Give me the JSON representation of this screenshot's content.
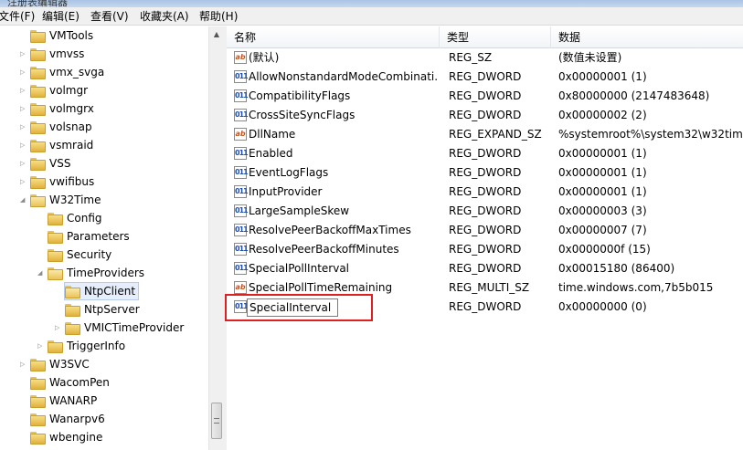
{
  "window": {
    "title": "注册表编辑器"
  },
  "menu": {
    "file": "文件(F)",
    "edit": "编辑(E)",
    "view": "查看(V)",
    "favorites": "收藏夹(A)",
    "help": "帮助(H)"
  },
  "tree": {
    "items": [
      {
        "label": "VMTools",
        "level": 1,
        "expander": ""
      },
      {
        "label": "vmvss",
        "level": 1,
        "expander": "▷"
      },
      {
        "label": "vmx_svga",
        "level": 1,
        "expander": "▷"
      },
      {
        "label": "volmgr",
        "level": 1,
        "expander": "▷"
      },
      {
        "label": "volmgrx",
        "level": 1,
        "expander": "▷"
      },
      {
        "label": "volsnap",
        "level": 1,
        "expander": "▷"
      },
      {
        "label": "vsmraid",
        "level": 1,
        "expander": "▷"
      },
      {
        "label": "VSS",
        "level": 1,
        "expander": "▷"
      },
      {
        "label": "vwifibus",
        "level": 1,
        "expander": "▷"
      },
      {
        "label": "W32Time",
        "level": 1,
        "expander": "◢"
      },
      {
        "label": "Config",
        "level": 2,
        "expander": ""
      },
      {
        "label": "Parameters",
        "level": 2,
        "expander": ""
      },
      {
        "label": "Security",
        "level": 2,
        "expander": ""
      },
      {
        "label": "TimeProviders",
        "level": 2,
        "expander": "◢"
      },
      {
        "label": "NtpClient",
        "level": 3,
        "expander": ""
      },
      {
        "label": "NtpServer",
        "level": 3,
        "expander": ""
      },
      {
        "label": "VMICTimeProvider",
        "level": 3,
        "expander": "▷"
      },
      {
        "label": "TriggerInfo",
        "level": 2,
        "expander": "▷"
      },
      {
        "label": "W3SVC",
        "level": 1,
        "expander": "▷"
      },
      {
        "label": "WacomPen",
        "level": 1,
        "expander": ""
      },
      {
        "label": "WANARP",
        "level": 1,
        "expander": ""
      },
      {
        "label": "Wanarpv6",
        "level": 1,
        "expander": ""
      },
      {
        "label": "wbengine",
        "level": 1,
        "expander": ""
      }
    ]
  },
  "list": {
    "columns": {
      "name": "名称",
      "type": "类型",
      "data": "数据"
    },
    "rows": [
      {
        "icon": "ab",
        "name": "(默认)",
        "type": "REG_SZ",
        "data": "(数值未设置)"
      },
      {
        "icon": "011",
        "name": "AllowNonstandardModeCombinati...",
        "type": "REG_DWORD",
        "data": "0x00000001 (1)"
      },
      {
        "icon": "011",
        "name": "CompatibilityFlags",
        "type": "REG_DWORD",
        "data": "0x80000000 (2147483648)"
      },
      {
        "icon": "011",
        "name": "CrossSiteSyncFlags",
        "type": "REG_DWORD",
        "data": "0x00000002 (2)"
      },
      {
        "icon": "ab",
        "name": "DllName",
        "type": "REG_EXPAND_SZ",
        "data": "%systemroot%\\system32\\w32time"
      },
      {
        "icon": "011",
        "name": "Enabled",
        "type": "REG_DWORD",
        "data": "0x00000001 (1)"
      },
      {
        "icon": "011",
        "name": "EventLogFlags",
        "type": "REG_DWORD",
        "data": "0x00000001 (1)"
      },
      {
        "icon": "011",
        "name": "InputProvider",
        "type": "REG_DWORD",
        "data": "0x00000001 (1)"
      },
      {
        "icon": "011",
        "name": "LargeSampleSkew",
        "type": "REG_DWORD",
        "data": "0x00000003 (3)"
      },
      {
        "icon": "011",
        "name": "ResolvePeerBackoffMaxTimes",
        "type": "REG_DWORD",
        "data": "0x00000007 (7)"
      },
      {
        "icon": "011",
        "name": "ResolvePeerBackoffMinutes",
        "type": "REG_DWORD",
        "data": "0x0000000f (15)"
      },
      {
        "icon": "011",
        "name": "SpecialPollInterval",
        "type": "REG_DWORD",
        "data": "0x00015180 (86400)"
      },
      {
        "icon": "ab",
        "name": "SpecialPollTimeRemaining",
        "type": "REG_MULTI_SZ",
        "data": "time.windows.com,7b5b015"
      }
    ],
    "editing_row": {
      "icon": "011",
      "name_value": "SpecialInterval",
      "type": "REG_DWORD",
      "data": "0x00000000 (0)"
    }
  },
  "colors": {
    "highlight": "#e02020",
    "selection": "#e6eefb"
  }
}
